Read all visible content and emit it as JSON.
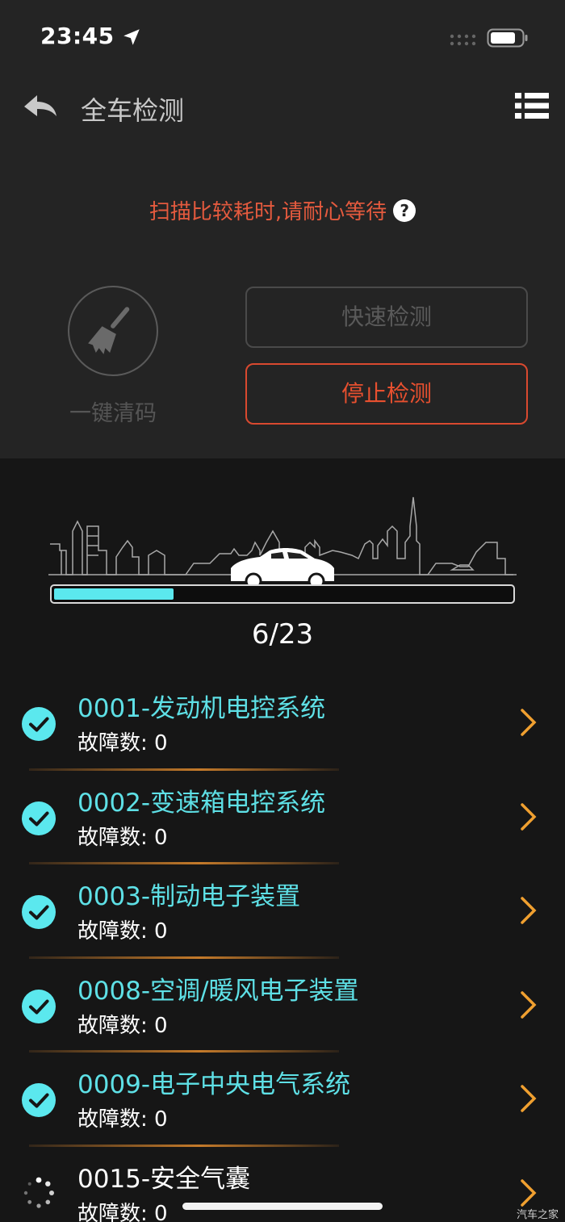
{
  "status_bar": {
    "time": "23:45"
  },
  "header": {
    "title": "全车检测"
  },
  "hint": {
    "text": "扫描比较耗时,请耐心等待",
    "help": "?"
  },
  "actions": {
    "clear_label": "一键清码",
    "quick_label": "快速检测",
    "stop_label": "停止检测"
  },
  "progress": {
    "text": "6/23",
    "completed": 6,
    "total": 23
  },
  "items": [
    {
      "title": "0001-发动机电控系统",
      "faults": "故障数: 0",
      "state": "done"
    },
    {
      "title": "0002-变速箱电控系统",
      "faults": "故障数: 0",
      "state": "done"
    },
    {
      "title": "0003-制动电子装置",
      "faults": "故障数: 0",
      "state": "done"
    },
    {
      "title": "0008-空调/暖风电子装置",
      "faults": "故障数: 0",
      "state": "done"
    },
    {
      "title": "0009-电子中央电气系统",
      "faults": "故障数: 0",
      "state": "done"
    },
    {
      "title": "0015-安全气囊",
      "faults": "故障数: 0",
      "state": "scanning"
    }
  ],
  "watermark": "汽车之家",
  "colors": {
    "accent": "#5be8ee",
    "warning": "#e45a3e",
    "chevron": "#f0a030"
  }
}
